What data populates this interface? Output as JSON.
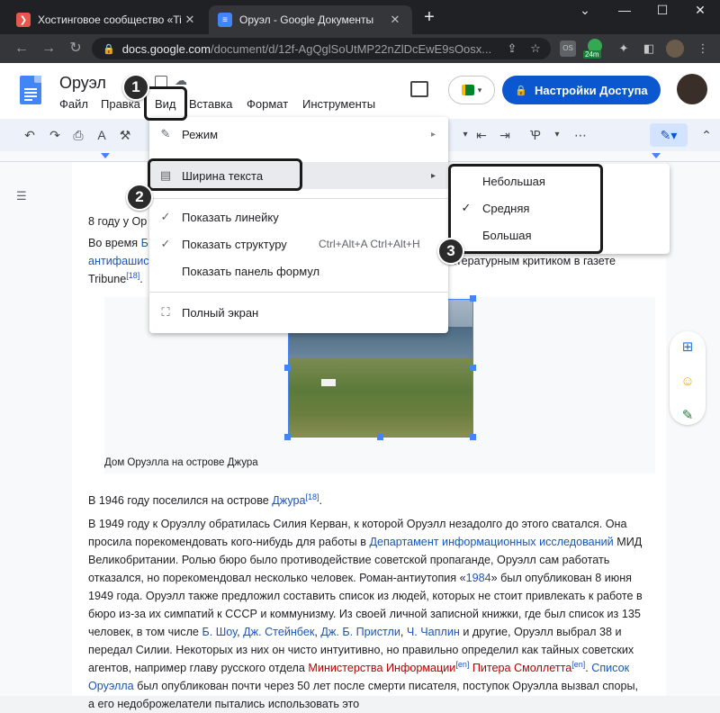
{
  "browser": {
    "tabs": [
      {
        "title": "Хостинговое сообщество «Time"
      },
      {
        "title": "Оруэл - Google Документы"
      }
    ],
    "new_tab_label": "+",
    "url_host": "docs.google.com",
    "url_path": "/document/d/12f-AgQglSoUtMP22nZlDcEwE9sOosx...",
    "ext_badge": "24m"
  },
  "docs": {
    "title": "Оруэл",
    "menu": [
      "Файл",
      "Правка",
      "Вид",
      "Вставка",
      "Формат",
      "Инструменты"
    ],
    "share_label": "Настройки Доступа"
  },
  "view_menu": {
    "items": [
      {
        "label": "Режим",
        "icon": "pencil-icon",
        "check": "",
        "shortcut": "",
        "arrow": "▸"
      },
      {
        "label": "Ширина текста",
        "icon": "text-width-icon",
        "check": "",
        "shortcut": "",
        "arrow": "▸"
      },
      {
        "label": "Показать линейку",
        "icon": "",
        "check": "✓",
        "shortcut": "",
        "arrow": ""
      },
      {
        "label": "Показать структуру",
        "icon": "",
        "check": "✓",
        "shortcut": "Ctrl+Alt+A Ctrl+Alt+H",
        "arrow": ""
      },
      {
        "label": "Показать панель формул",
        "icon": "",
        "check": "",
        "shortcut": "",
        "arrow": ""
      },
      {
        "label": "Полный экран",
        "icon": "fullscreen-icon",
        "check": "",
        "shortcut": "",
        "arrow": ""
      }
    ]
  },
  "width_submenu": {
    "items": [
      {
        "label": "Небольшая",
        "checked": false
      },
      {
        "label": "Средняя",
        "checked": true
      },
      {
        "label": "Большая",
        "checked": false
      }
    ]
  },
  "steps": [
    "1",
    "2",
    "3"
  ],
  "document": {
    "p0": "8 году у Ор",
    "p1a": "Во время ",
    "p1b": "Б",
    "p1c": "антифашис",
    "p1d": "итературным критиком в газете",
    "p1e": "Tribune",
    "p1f": "[18]",
    "p1g": ".",
    "caption": "Дом Оруэлла на острове Джура",
    "p2a": "В 1946 году поселился на острове ",
    "p2b": "Джура",
    "p2c": "[18]",
    "p2d": ".",
    "p3": [
      {
        "t": "В 1949 году к Оруэллу обратилась Силия Керван, к которой Оруэлл незадолго до этого сватался. Она просила порекомендовать кого-нибудь для работы в ",
        "c": ""
      },
      {
        "t": "Департамент информационных исследований",
        "c": "link"
      },
      {
        "t": " МИД Великобритании. Ролью бюро было противодействие советской пропаганде, Оруэлл сам работать отказался, но порекомендовал несколько человек. Роман-антиутопия «",
        "c": ""
      },
      {
        "t": "1984",
        "c": "link"
      },
      {
        "t": "» был опубликован 8 июня 1949 года. Оруэлл также предложил составить список из людей, которых не стоит привлекать к работе в бюро из-за их симпатий к СССР и коммунизму. Из своей личной записной книжки, где был список из 135 человек, в том числе ",
        "c": ""
      },
      {
        "t": "Б. Шоу",
        "c": "link"
      },
      {
        "t": ", ",
        "c": ""
      },
      {
        "t": "Дж. Стейнбек",
        "c": "link"
      },
      {
        "t": ", ",
        "c": ""
      },
      {
        "t": "Дж. Б. Пристли",
        "c": "link"
      },
      {
        "t": ", ",
        "c": ""
      },
      {
        "t": "Ч. Чаплин",
        "c": "link"
      },
      {
        "t": " и другие, Оруэлл выбрал 38 и передал Силии. Некоторых из них он чисто интуитивно, но правильно определил как тайных советских агентов, например главу русского отдела ",
        "c": ""
      },
      {
        "t": "Министерства Информации",
        "c": "red"
      },
      {
        "t": "[en]",
        "c": "supl"
      },
      {
        "t": " ",
        "c": ""
      },
      {
        "t": "Питера Смоллетта",
        "c": "red"
      },
      {
        "t": "[en]",
        "c": "supl"
      },
      {
        "t": ". ",
        "c": ""
      },
      {
        "t": "Список Оруэлла",
        "c": "link"
      },
      {
        "t": " был опубликован почти через 50 лет после смерти писателя, поступок Оруэлла вызвал споры, а его недоброжелатели пытались использовать это",
        "c": ""
      }
    ]
  },
  "colors": {
    "accent": "#0b57d0",
    "badge": "#2b2b2b",
    "link": "#1a55b8",
    "red_link": "#ba0000"
  }
}
